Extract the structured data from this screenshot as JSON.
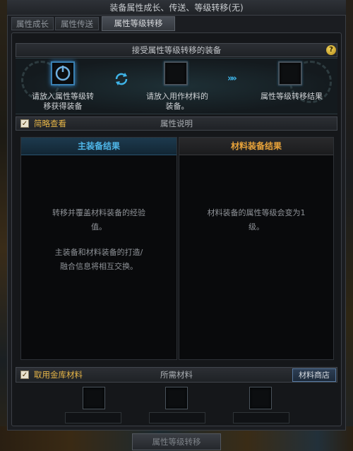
{
  "window": {
    "title": "装备属性成长、传送、等级转移(无)"
  },
  "tabs": [
    {
      "label": "属性成长",
      "active": false
    },
    {
      "label": "属性传送",
      "active": false
    },
    {
      "label": "属性等级转移",
      "active": true
    }
  ],
  "transfer": {
    "header": "接受属性等级转移的装备",
    "help_label": "?",
    "slots": [
      {
        "caption_line1": "请放入属性等级转",
        "caption_line2": "移获得装备"
      },
      {
        "caption_line1": "请放入用作材料的",
        "caption_line2": "装备。"
      },
      {
        "caption_line1": "属性等级转移结果",
        "caption_line2": ""
      }
    ]
  },
  "description": {
    "simple_view_label": "简略查看",
    "simple_view_checked": true,
    "header": "属性说明"
  },
  "results": {
    "main": {
      "header": "主装备结果",
      "text_line1": "转移并覆盖材料装备的经验",
      "text_line2": "值。",
      "text_line3": "主装备和材料装备的打造/",
      "text_line4": "融合信息将相互交换。"
    },
    "material": {
      "header": "材料装备结果",
      "text_line1": "材料装备的属性等级会变为1",
      "text_line2": "级。"
    }
  },
  "materials": {
    "use_vault_label": "取用金库材料",
    "use_vault_checked": true,
    "header": "所需材料",
    "shop_button": "材料商店"
  },
  "actions": {
    "transfer_button": "属性等级转移"
  },
  "colors": {
    "gold": "#e6b547",
    "blue_header": "#4fb6e8",
    "orange_header": "#e8a33a"
  }
}
